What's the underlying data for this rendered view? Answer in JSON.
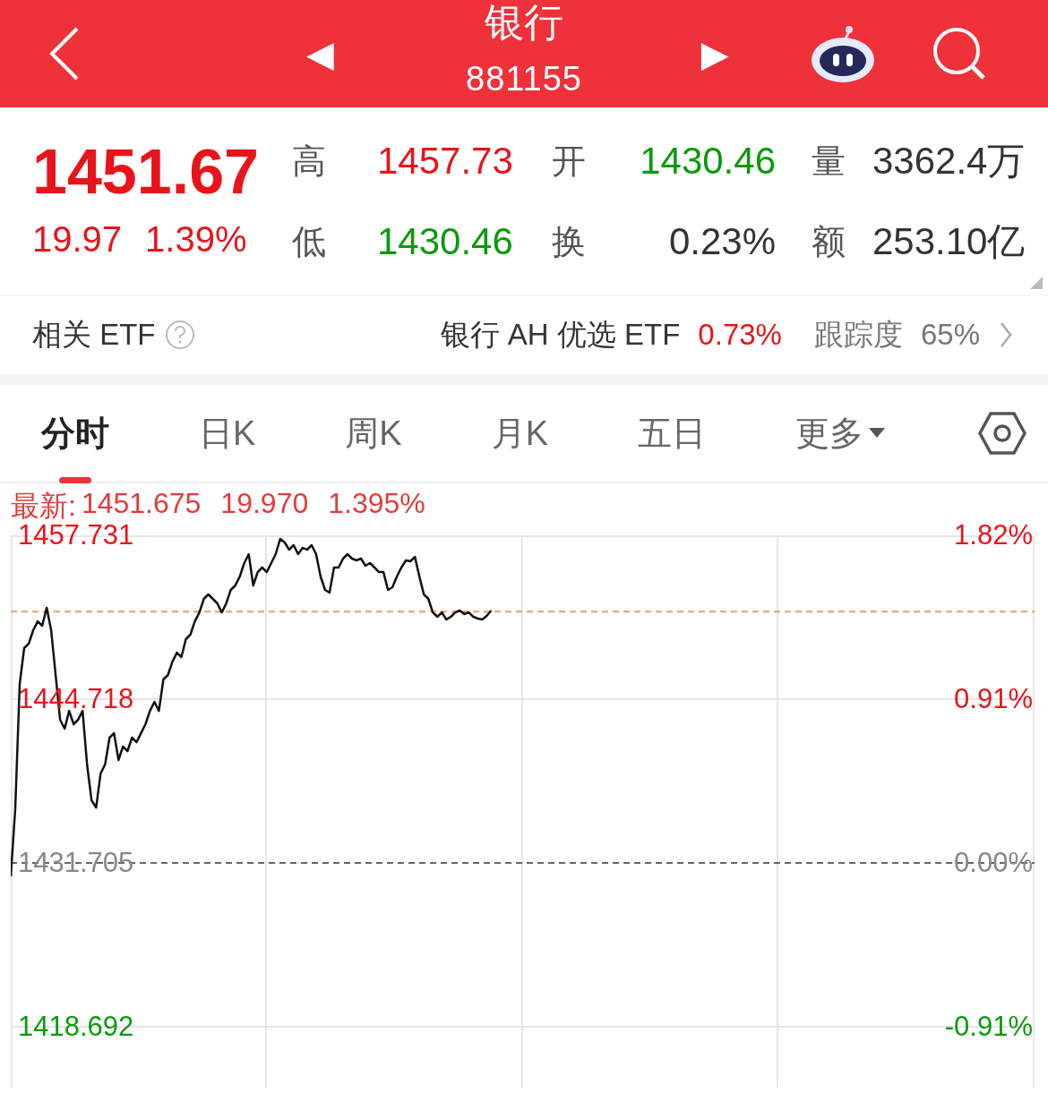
{
  "header": {
    "prev": "◀",
    "title": "银行",
    "code": "881155",
    "next": "▶"
  },
  "quote": {
    "price": "1451.67",
    "change": "19.97",
    "percent": "1.39%",
    "color": "#e8141a",
    "stats": [
      {
        "label": "高",
        "value": "1457.73",
        "color": "#e8141a"
      },
      {
        "label": "开",
        "value": "1430.46",
        "color": "#0a9a0a"
      },
      {
        "label": "量",
        "value": "3362.4万",
        "color": "#333333"
      },
      {
        "label": "低",
        "value": "1430.46",
        "color": "#0a9a0a"
      },
      {
        "label": "换",
        "value": "0.23%",
        "color": "#333333"
      },
      {
        "label": "额",
        "value": "253.10亿",
        "color": "#333333"
      }
    ]
  },
  "etf": {
    "label": "相关 ETF",
    "name": "银行 AH 优选 ETF",
    "percent": "0.73%",
    "color": "#e8141a",
    "tracking_label": "跟踪度",
    "tracking": "65%"
  },
  "tabs": [
    {
      "label": "分时",
      "selected": true
    },
    {
      "label": "日K",
      "selected": false
    },
    {
      "label": "周K",
      "selected": false
    },
    {
      "label": "月K",
      "selected": false
    },
    {
      "label": "五日",
      "selected": false
    },
    {
      "label": "更多",
      "selected": false,
      "kind": "menu"
    }
  ],
  "latest": {
    "label": "最新:",
    "price": "1451.675",
    "change": "19.970",
    "percent": "1.395%"
  },
  "chart": {
    "percent_labels": [
      {
        "label": "1.82%",
        "color": "#e8141a"
      },
      {
        "label": "0.91%",
        "color": "#e8141a"
      },
      {
        "label": "0.00%",
        "color": "#888888"
      },
      {
        "label": "-0.91%",
        "color": "#0a9a0a"
      }
    ],
    "chart_data": {
      "type": "line",
      "ylim": [
        1413.857,
        1457.731
      ],
      "yticks": [
        {
          "value": 1457.731,
          "label": "1457.731"
        },
        {
          "value": 1444.718,
          "label": "1444.718"
        },
        {
          "value": 1431.705,
          "label": "1431.705"
        },
        {
          "value": 1418.692,
          "label": "1418.692"
        }
      ],
      "categories": [
        null,
        null,
        null,
        null,
        null,
        null,
        null,
        null,
        null,
        null,
        null,
        null,
        null,
        null,
        null,
        null,
        null,
        null,
        null,
        null,
        null,
        null,
        null,
        null,
        null,
        null,
        null,
        null,
        null,
        null,
        null,
        null,
        null,
        null,
        null,
        null,
        null,
        null,
        null,
        null,
        null,
        null,
        null,
        null,
        null,
        null,
        null,
        null,
        null,
        null,
        null,
        null,
        null,
        null,
        null,
        null,
        null,
        null,
        null,
        null,
        null,
        null,
        null,
        null,
        null,
        null,
        null,
        null,
        null,
        null,
        null,
        null,
        null,
        null,
        null,
        null,
        null,
        null,
        null,
        null,
        null,
        null,
        null,
        null,
        null,
        null,
        null,
        null,
        null,
        null,
        null,
        null,
        null,
        null,
        null,
        null,
        null,
        null,
        null,
        null,
        null,
        null,
        null,
        null,
        null,
        null,
        null,
        null,
        null,
        null,
        null,
        null,
        null,
        null,
        null,
        null,
        null,
        null,
        null,
        null,
        null,
        null,
        null,
        null,
        null,
        null,
        null,
        null,
        null,
        null,
        null,
        null,
        null,
        null,
        null,
        null,
        null,
        null,
        null,
        null,
        null,
        null,
        null,
        null,
        null,
        null,
        null,
        null,
        null,
        null,
        null,
        null,
        null,
        null,
        null,
        null,
        null,
        null,
        null,
        null,
        null,
        null,
        null,
        null,
        null,
        null,
        null,
        null,
        null,
        null,
        null,
        null,
        null,
        null,
        null,
        null,
        null,
        null,
        null,
        null,
        null,
        null,
        null,
        null,
        null,
        null,
        null,
        null,
        null,
        null,
        null,
        null,
        null,
        null,
        null,
        null,
        null,
        null,
        null,
        null,
        null,
        null,
        null,
        null,
        null,
        null,
        null,
        null,
        null,
        null,
        null,
        null,
        null,
        null,
        null,
        null,
        null,
        null,
        null,
        null,
        null,
        null,
        null,
        null,
        null,
        null,
        null,
        null,
        null
      ],
      "ref_lines": [
        {
          "axis": "y",
          "value": 1451.675,
          "color": "#e0a070"
        },
        {
          "axis": "y",
          "value": 1431.705,
          "color": "#666666"
        }
      ],
      "series": [
        {
          "color": "#111111",
          "values": [
            1430.64,
            1435.97,
            1445.93,
            1448.77,
            1449.13,
            1450.19,
            1450.9,
            1450.55,
            1451.97,
            1450.19,
            1446.64,
            1443.08,
            1442.37,
            1443.79,
            1442.73,
            1443.08,
            1443.79,
            1439.53,
            1436.68,
            1436.11,
            1438.81,
            1439.53,
            1441.66,
            1442.01,
            1439.88,
            1440.95,
            1440.59,
            1441.66,
            1441.3,
            1442.01,
            1442.73,
            1443.79,
            1444.5,
            1443.79,
            1446.28,
            1446.64,
            1447.7,
            1448.41,
            1448.06,
            1449.48,
            1449.84,
            1450.9,
            1451.61,
            1452.68,
            1453.04,
            1452.68,
            1452.33,
            1451.61,
            1452.33,
            1453.39,
            1453.75,
            1454.46,
            1455.53,
            1456.24,
            1453.75,
            1454.81,
            1455.17,
            1454.81,
            1455.53,
            1456.24,
            1457.45,
            1457.16,
            1456.59,
            1456.95,
            1456.24,
            1456.73,
            1456.59,
            1456.95,
            1456.24,
            1454.46,
            1453.39,
            1453.18,
            1455.17,
            1455.17,
            1455.88,
            1456.24,
            1455.88,
            1455.74,
            1455.88,
            1455.31,
            1455.53,
            1455.17,
            1454.81,
            1454.81,
            1453.39,
            1453.61,
            1454.46,
            1455.17,
            1455.74,
            1455.67,
            1456.02,
            1454.46,
            1453.04,
            1452.68,
            1451.61,
            1451.26,
            1451.61,
            1451.05,
            1451.26,
            1451.61,
            1451.76,
            1451.47,
            1451.61,
            1451.26,
            1451.12,
            1451.05,
            1451.33,
            1451.76,
            null,
            null,
            null,
            null,
            null,
            null,
            null,
            null,
            null,
            null,
            null,
            null,
            null,
            null,
            null,
            null,
            null,
            null,
            null,
            null,
            null,
            null,
            null,
            null,
            null,
            null,
            null,
            null,
            null,
            null,
            null,
            null,
            null,
            null,
            null,
            null,
            null,
            null,
            null,
            null,
            null,
            null,
            null,
            null,
            null,
            null,
            null,
            null,
            null,
            null,
            null,
            null,
            null,
            null,
            null,
            null,
            null,
            null,
            null,
            null,
            null,
            null,
            null,
            null,
            null,
            null,
            null,
            null,
            null,
            null,
            null,
            null,
            null,
            null,
            null,
            null,
            null,
            null,
            null,
            null,
            null,
            null,
            null,
            null,
            null,
            null,
            null,
            null,
            null,
            null,
            null,
            null,
            null,
            null,
            null,
            null,
            null,
            null,
            null,
            null,
            null,
            null,
            null,
            null,
            null,
            null,
            null,
            null,
            null,
            null,
            null,
            null,
            null,
            null,
            null,
            null,
            null,
            null,
            null,
            null,
            null
          ]
        }
      ]
    }
  }
}
